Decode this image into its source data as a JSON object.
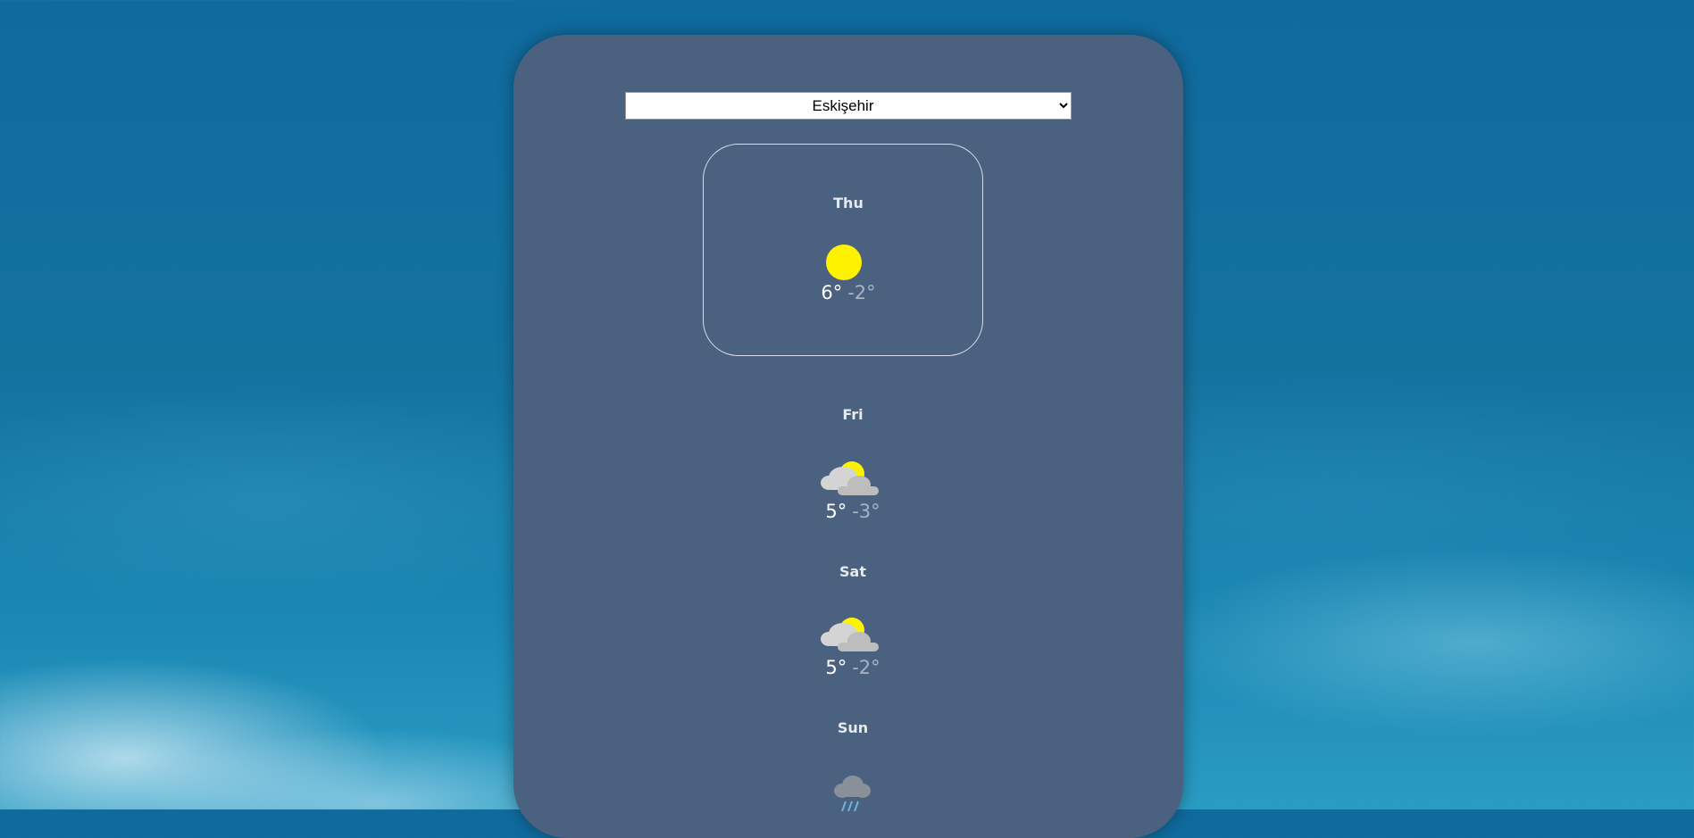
{
  "city_select": {
    "selected": "Eskişehir",
    "options": [
      "Eskişehir"
    ]
  },
  "forecast": [
    {
      "day": "Thu",
      "icon": "sun-icon",
      "max": "6°",
      "min": "-2°"
    },
    {
      "day": "Fri",
      "icon": "partly-cloudy-icon",
      "max": "5°",
      "min": "-3°"
    },
    {
      "day": "Sat",
      "icon": "partly-cloudy-icon",
      "max": "5°",
      "min": "-2°"
    },
    {
      "day": "Sun",
      "icon": "rain-cloud-icon",
      "max": "",
      "min": ""
    }
  ],
  "colors": {
    "panel": "#4a6180",
    "sun": "#fff200",
    "cloud": "#c9c9c9",
    "rain_cloud": "#8a9098",
    "rain": "#6fb3e0",
    "min_temp": "#a8b4c4"
  }
}
